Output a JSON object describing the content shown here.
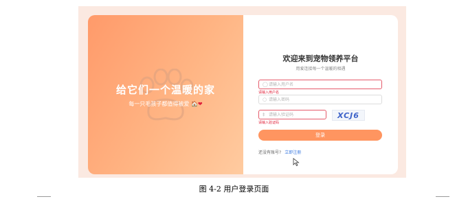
{
  "left_panel": {
    "headline": "给它们一个温暖的家",
    "tagline": "每一只毛孩子都值得被爱",
    "house_emoji": "🏠",
    "heart_emoji": "❤"
  },
  "login": {
    "title": "欢迎来到宠物领养平台",
    "subtitle": "用爱连接每一个温暖的相遇",
    "username_placeholder": "请输入用户名",
    "username_error": "请输入用户名",
    "password_placeholder": "请输入密码",
    "captcha_placeholder": "请输入验证码",
    "captcha_error": "请输入验证码",
    "captcha_code": "XCJ6",
    "login_button": "登录",
    "no_account_text": "还没有账号?",
    "register_link": "立即注册"
  },
  "caption": "图 4-2  用户登录页面",
  "colors": {
    "brand_orange": "#ff9560",
    "error_red": "#e0213a",
    "link_blue": "#3c7ae0"
  }
}
